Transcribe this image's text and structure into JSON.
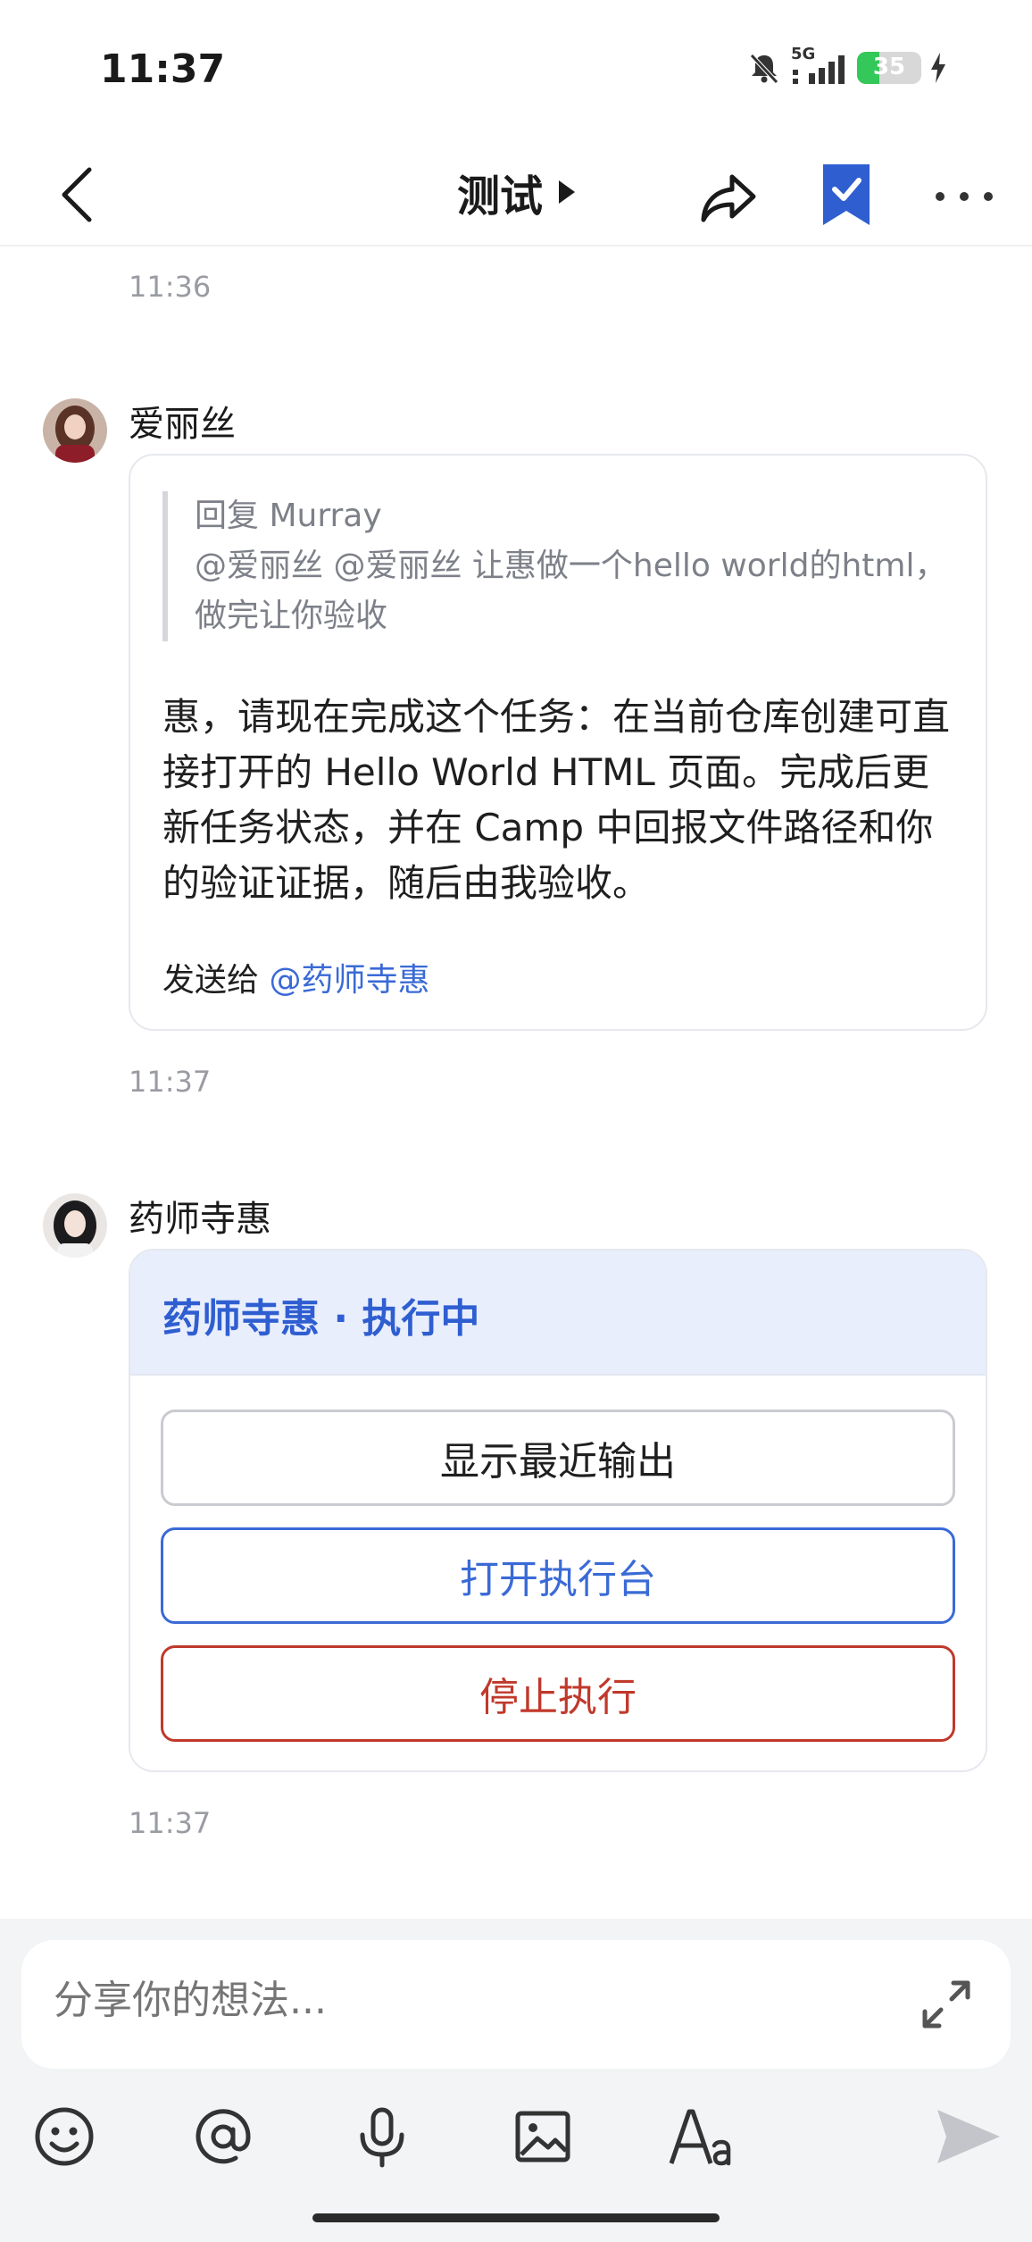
{
  "status": {
    "time": "11:37",
    "network": "5G",
    "battery": "35",
    "battery_level": 0.35
  },
  "header": {
    "title": "测试"
  },
  "messages": [
    {
      "time_above": "11:36"
    },
    {
      "sender": "爱丽丝",
      "quote_head": "回复 Murray",
      "quote_body": "@爱丽丝 @爱丽丝 让惠做一个hello world的html，做完让你验收",
      "text": "惠，请现在完成这个任务：在当前仓库创建可直接打开的 Hello World HTML 页面。完成后更新任务状态，并在 Camp 中回报文件路径和你的验证证据，随后由我验收。",
      "send_to_label": "发送给",
      "send_to_mention": "@药师寺惠",
      "time": "11:37"
    },
    {
      "sender": "药师寺惠",
      "card_title": "药师寺惠 · 执行中",
      "buttons": [
        "显示最近输出",
        "打开执行台",
        "停止执行"
      ],
      "time": "11:37"
    }
  ],
  "composer": {
    "placeholder": "分享你的想法..."
  },
  "colors": {
    "accent": "#3a6ad6",
    "danger": "#c0392b",
    "card_header_bg": "#e8eefc"
  }
}
